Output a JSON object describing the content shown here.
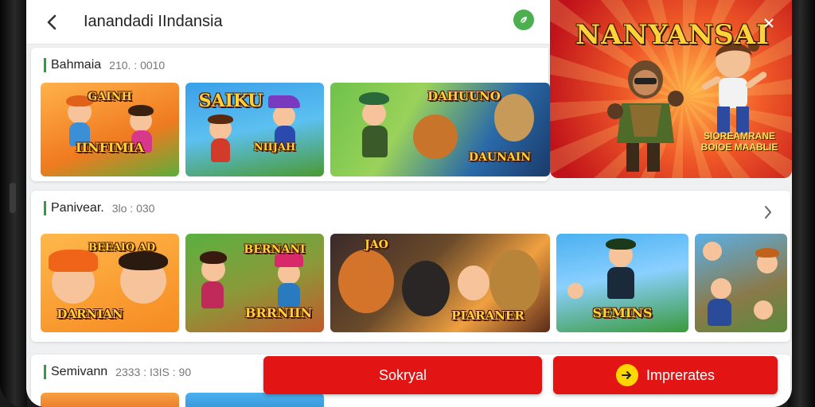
{
  "header": {
    "title": "Ianandadi IIndansia",
    "back_icon": "chevron-left-icon",
    "status_icon": "green-leaf-icon"
  },
  "hero": {
    "title": "NANYANSAI",
    "subtitle": "SIOREAMRANE BOIOE MAABLIE",
    "close_icon": "close-icon"
  },
  "sections": [
    {
      "title": "Bahmaia",
      "meta": "210. : 0010",
      "cards": [
        {
          "top_label": "GAINH",
          "bottom_label": "IINFIMIA"
        },
        {
          "top_label": "SAIKU",
          "bottom_label": "NIIJAH"
        },
        {
          "top_label": "DAHUUNO",
          "bottom_label": "DAUNAIN"
        }
      ]
    },
    {
      "title": "Panivear.",
      "meta": "3lo : 030",
      "arrow_icon": "chevron-right-icon",
      "cards": [
        {
          "top_label": "BEEAIO AD",
          "bottom_label": "DARNIAN"
        },
        {
          "top_label": "BERNANI",
          "bottom_label": "BRRNIIN"
        },
        {
          "top_label": "JAO",
          "bottom_label": "PIARANER"
        },
        {
          "top_label": "",
          "bottom_label": "SEMINS"
        },
        {
          "top_label": "",
          "bottom_label": ""
        }
      ]
    },
    {
      "title": "Semivann",
      "meta": "2333 : I3IS : 90"
    }
  ],
  "actions": {
    "primary_label": "Sokryal",
    "secondary_label": "Imprerates",
    "secondary_icon": "arrow-right-icon"
  },
  "colors": {
    "accent_red": "#e31414",
    "section_bar_green": "#2e9e3e",
    "title_gold": "#ffd23a"
  }
}
